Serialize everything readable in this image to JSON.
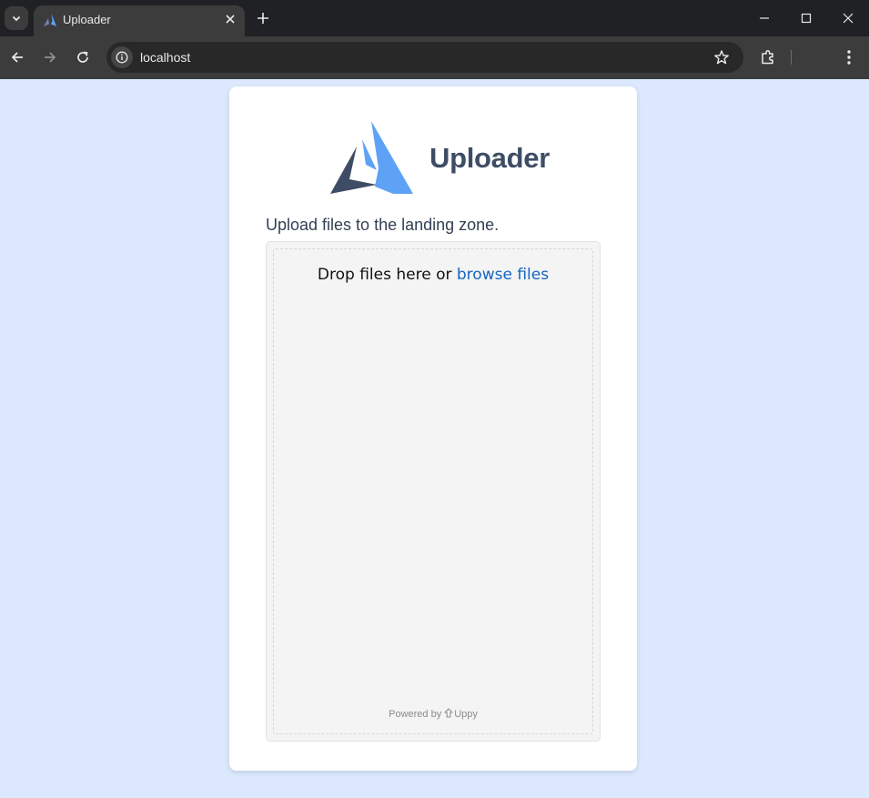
{
  "browser": {
    "tab_title": "Uploader",
    "url": "localhost"
  },
  "page": {
    "app_title": "Uploader",
    "subtitle": "Upload files to the landing zone.",
    "dropzone": {
      "drop_text": "Drop files here or ",
      "browse_link": "browse files",
      "powered_by": "Powered by",
      "powered_brand": "Uppy"
    }
  },
  "colors": {
    "page_bg": "#dbe8fe",
    "logo_blue": "#5ea2f6",
    "logo_dark": "#3e4d65",
    "link": "#1565c0"
  },
  "icons": [
    "chevron-down-icon",
    "uploader-favicon-icon",
    "close-icon",
    "plus-icon",
    "minimize-icon",
    "maximize-icon",
    "window-close-icon",
    "back-arrow-icon",
    "forward-arrow-icon",
    "reload-icon",
    "info-icon",
    "star-icon",
    "extensions-icon",
    "more-vert-icon",
    "uploader-logo-icon",
    "uppy-icon"
  ]
}
